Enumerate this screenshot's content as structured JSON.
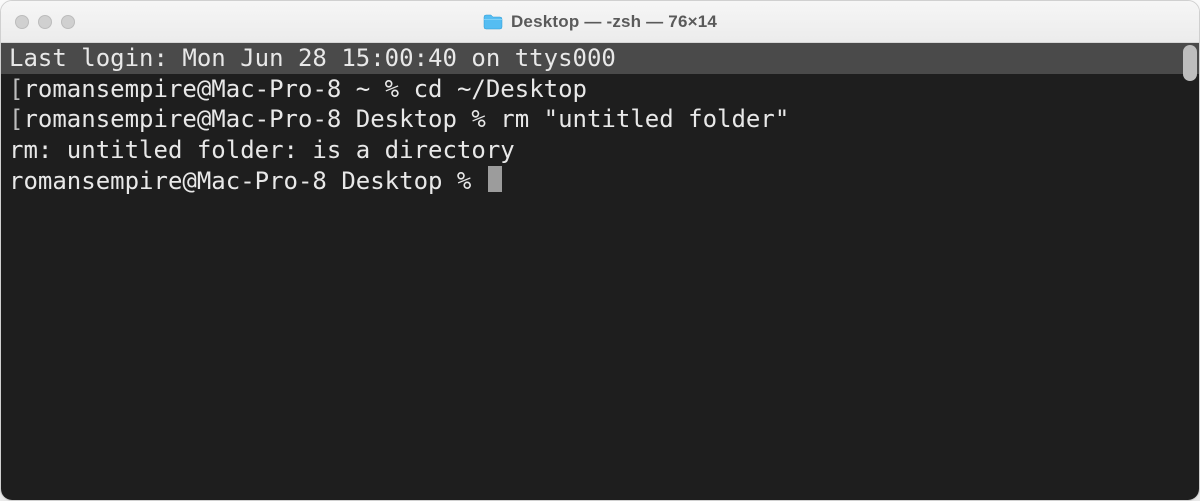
{
  "window": {
    "title": "Desktop — -zsh — 76×14"
  },
  "terminal": {
    "lines": {
      "l0": "Last login: Mon Jun 28 15:00:40 on ttys000",
      "l1_prefix": "[",
      "l1_prompt": "romansempire@Mac-Pro-8 ~ % ",
      "l1_cmd": "cd ~/Desktop",
      "l2_prefix": "[",
      "l2_prompt": "romansempire@Mac-Pro-8 Desktop % ",
      "l2_cmd": "rm \"untitled folder\"",
      "l3": "rm: untitled folder: is a directory",
      "l4_prompt": "romansempire@Mac-Pro-8 Desktop % "
    }
  }
}
